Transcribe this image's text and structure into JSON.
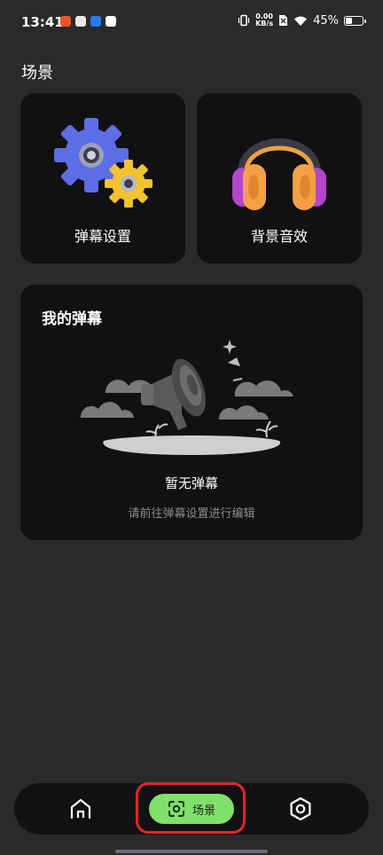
{
  "status_bar": {
    "time": "13:41",
    "net_speed_value": "0.00",
    "net_speed_unit": "KB/s",
    "battery": "45%",
    "battery_level": 0.45
  },
  "section": {
    "title": "场景"
  },
  "cards": [
    {
      "label": "弹幕设置",
      "icon": "gears-icon"
    },
    {
      "label": "背景音效",
      "icon": "headphones-icon"
    }
  ],
  "my_danmaku": {
    "title": "我的弹幕",
    "empty_title": "暂无弹幕",
    "empty_subtitle": "请前往弹幕设置进行编辑"
  },
  "bottom_nav": {
    "items": [
      {
        "icon": "home-icon"
      },
      {
        "label": "场景",
        "icon": "scan-icon",
        "active": true
      },
      {
        "icon": "settings-icon"
      }
    ]
  },
  "colors": {
    "background": "#2a2a2c",
    "card": "#111113",
    "accent_green": "#7fe06a",
    "highlight_red": "#e0262b"
  }
}
